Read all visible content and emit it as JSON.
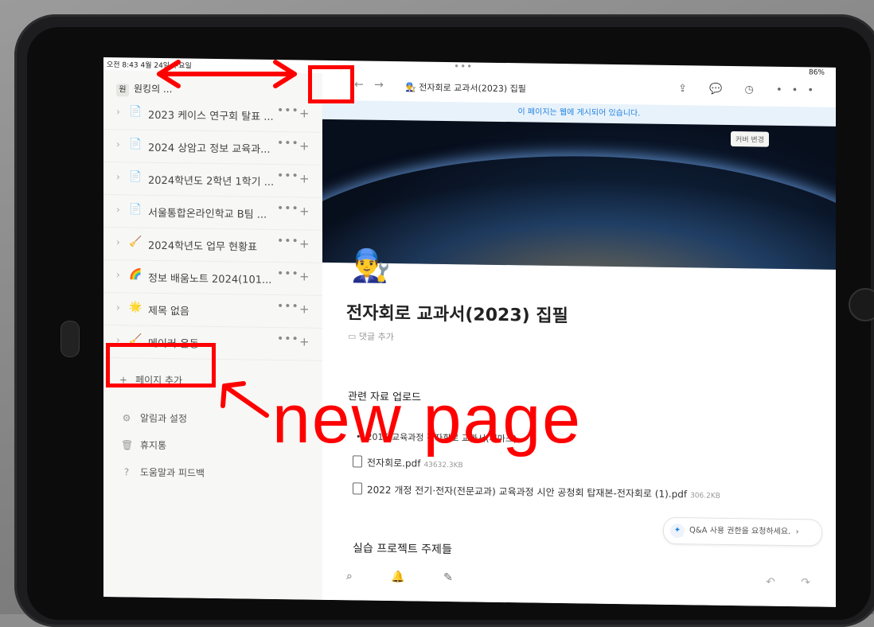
{
  "status": {
    "time": "오전 8:43  4월 24일 수요일",
    "right": "86%",
    "handle": "•••"
  },
  "sidebar": {
    "workspace_badge": "원",
    "workspace_name": "원킹의 ...",
    "items": [
      {
        "icon": "📄",
        "label": "2023 케이스 연구회 탈표 ...",
        "more": "•••",
        "add": "+"
      },
      {
        "icon": "📄",
        "label": "2024 상암고 정보 교육과...",
        "more": "•••",
        "add": "+"
      },
      {
        "icon": "📄",
        "label": "2024학년도 2학년 1학기 ...",
        "more": "•••",
        "add": "+"
      },
      {
        "icon": "📄",
        "label": "서울통합온라인학교 B팀 ...",
        "more": "•••",
        "add": "+"
      },
      {
        "icon": "🧹",
        "label": "2024학년도 업무 현황표",
        "more": "•••",
        "add": "+"
      },
      {
        "icon": "🌈",
        "label": "정보 배움노트 2024(101...",
        "more": "•••",
        "add": "+"
      },
      {
        "icon": "🌟",
        "label": "제목 없음",
        "more": "•••",
        "add": "+"
      },
      {
        "icon": "🧹",
        "label": "메이커 운동",
        "more": "•••",
        "add": "+"
      }
    ],
    "add_page": "페이지 추가",
    "links": [
      {
        "icon": "⚙",
        "label": "알림과 설정"
      },
      {
        "icon": "🗑",
        "label": "휴지통"
      },
      {
        "icon": "?",
        "label": "도움말과 피드백"
      }
    ]
  },
  "topbar": {
    "back": "←",
    "forward": "→",
    "breadcrumb_icon": "👨‍🔧",
    "breadcrumb": "전자회로 교과서(2023) 집필",
    "tools": "⇪ 💬 ◷ •••"
  },
  "main": {
    "publish_banner": "이 페이지는 웹에 게시되어 있습니다.",
    "cover_button": "커버 변경",
    "page_icon": "👨‍🔧",
    "title": "전자회로 교과서(2023) 집필",
    "add_comment": "댓글 추가",
    "section1": "관련 자료 업로드",
    "bullet": "2015 교육과정 전자회로 교과서(씨마스)",
    "files": [
      {
        "name": "전자회로.pdf",
        "size": "43632.3KB"
      },
      {
        "name": "2022 개정 전기·전자(전문교과) 교육과정 시안 공청회 탑재본-전자회로 (1).pdf",
        "size": "306.2KB"
      }
    ],
    "qa": "Q&A 사용 권한을 요청하세요.",
    "section2": "실습 프로젝트 주제들"
  },
  "bottombar": {
    "left": "⌕ 🔔 ✎",
    "right": "↶ ↷"
  },
  "annotation": {
    "text": "new page",
    "color": "#ff0000"
  }
}
